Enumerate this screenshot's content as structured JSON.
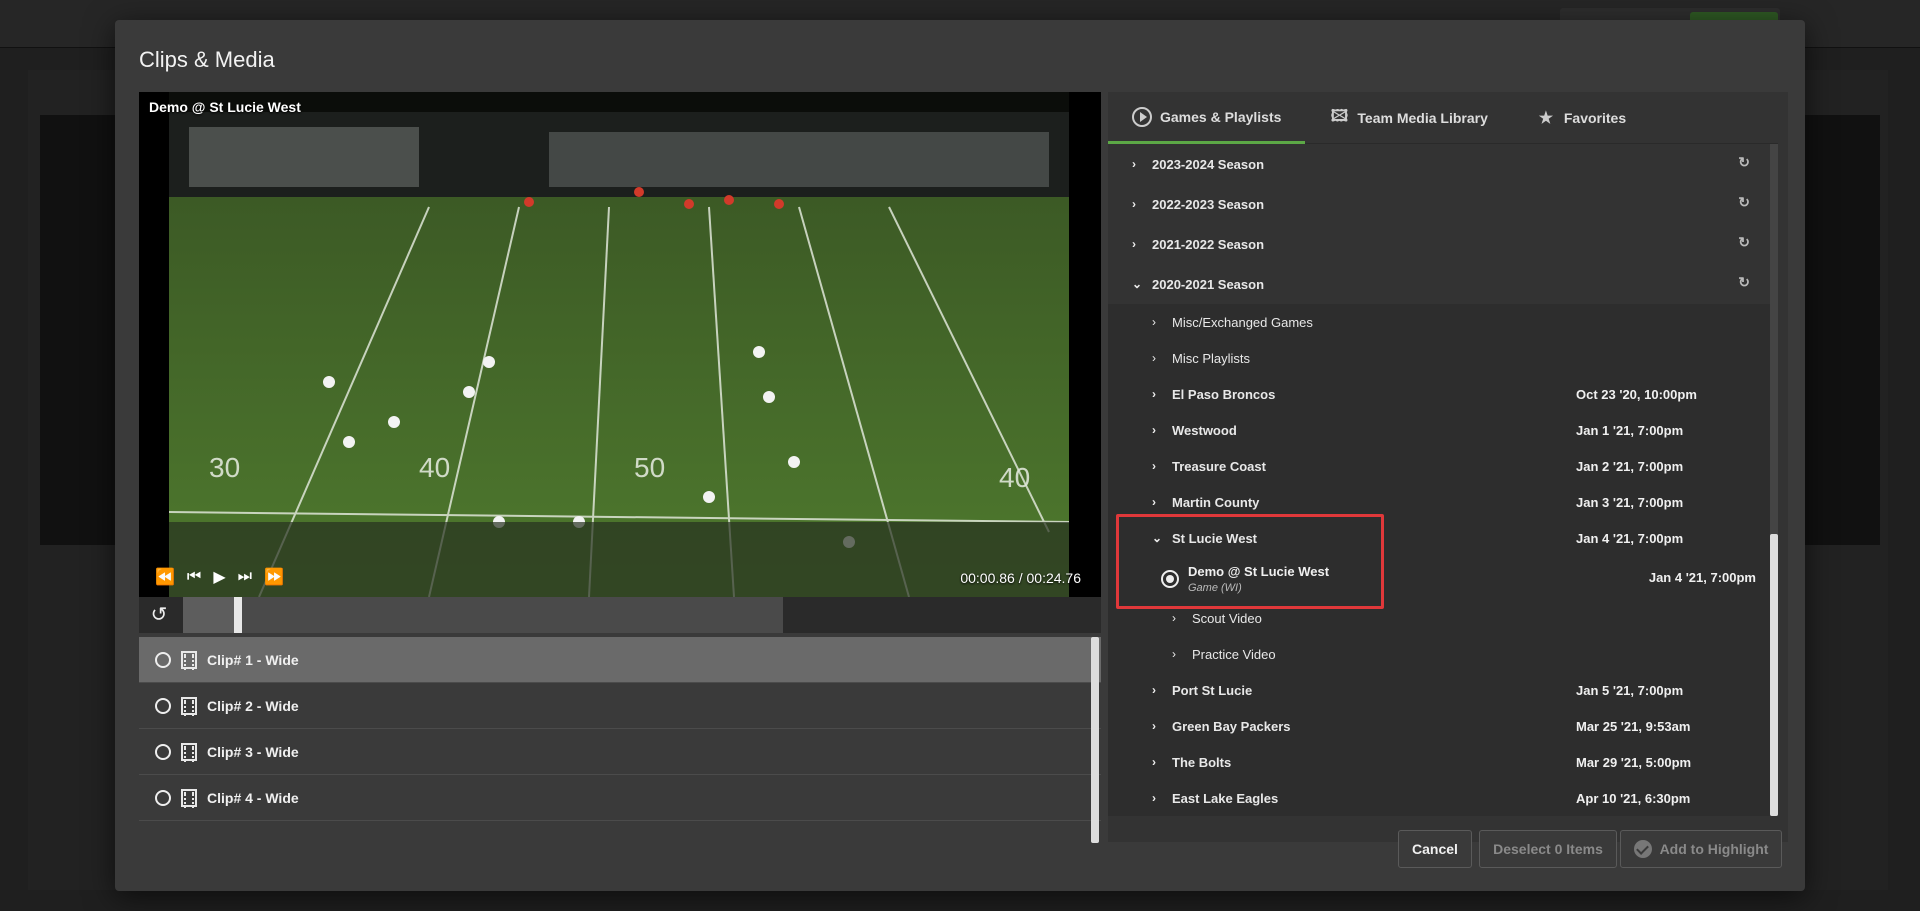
{
  "modal": {
    "title": "Clips & Media"
  },
  "player": {
    "video_title": "Demo @ St Lucie West",
    "current_time": "00:00.86",
    "separator": "/",
    "duration": "00:24.76",
    "progress_fraction": 0.035
  },
  "clips": [
    {
      "label": "Clip# 1 - Wide",
      "selected": true
    },
    {
      "label": "Clip# 2 - Wide",
      "selected": false
    },
    {
      "label": "Clip# 3 - Wide",
      "selected": false
    },
    {
      "label": "Clip# 4 - Wide",
      "selected": false
    }
  ],
  "tabs": [
    {
      "label": "Games & Playlists",
      "icon": "play-circle-icon",
      "active": true
    },
    {
      "label": "Team Media Library",
      "icon": "image-library-icon",
      "active": false
    },
    {
      "label": "Favorites",
      "icon": "star-icon",
      "active": false
    }
  ],
  "seasons": [
    {
      "label": "2023-2024 Season",
      "expanded": false
    },
    {
      "label": "2022-2023 Season",
      "expanded": false
    },
    {
      "label": "2021-2022 Season",
      "expanded": false
    },
    {
      "label": "2020-2021 Season",
      "expanded": true
    }
  ],
  "season_children": {
    "misc_games": "Misc/Exchanged Games",
    "misc_playlists": "Misc Playlists",
    "games": [
      {
        "name": "El Paso Broncos",
        "date": "Oct 23 '20, 10:00pm"
      },
      {
        "name": "Westwood",
        "date": "Jan 1 '21, 7:00pm"
      },
      {
        "name": "Treasure Coast",
        "date": "Jan 2 '21, 7:00pm"
      },
      {
        "name": "Martin County",
        "date": "Jan 3 '21, 7:00pm"
      },
      {
        "name": "St Lucie West",
        "date": "Jan 4 '21, 7:00pm"
      },
      {
        "name": "Port St Lucie",
        "date": "Jan 5 '21, 7:00pm"
      },
      {
        "name": "Green Bay Packers",
        "date": "Mar 25 '21, 9:53am"
      },
      {
        "name": "The Bolts",
        "date": "Mar 29 '21, 5:00pm"
      },
      {
        "name": "East Lake Eagles",
        "date": "Apr 10 '21, 6:30pm"
      }
    ],
    "expanded_game": {
      "item_name": "Demo @ St Lucie West",
      "item_type": "Game (WI)",
      "item_date": "Jan 4 '21, 7:00pm",
      "scout_video": "Scout Video",
      "practice_video": "Practice Video"
    }
  },
  "footer": {
    "cancel": "Cancel",
    "deselect": "Deselect 0 Items",
    "add_to_highlight": "Add to Highlight"
  },
  "colors": {
    "accent_green": "#5ca846",
    "highlight_red": "#e0383a"
  }
}
